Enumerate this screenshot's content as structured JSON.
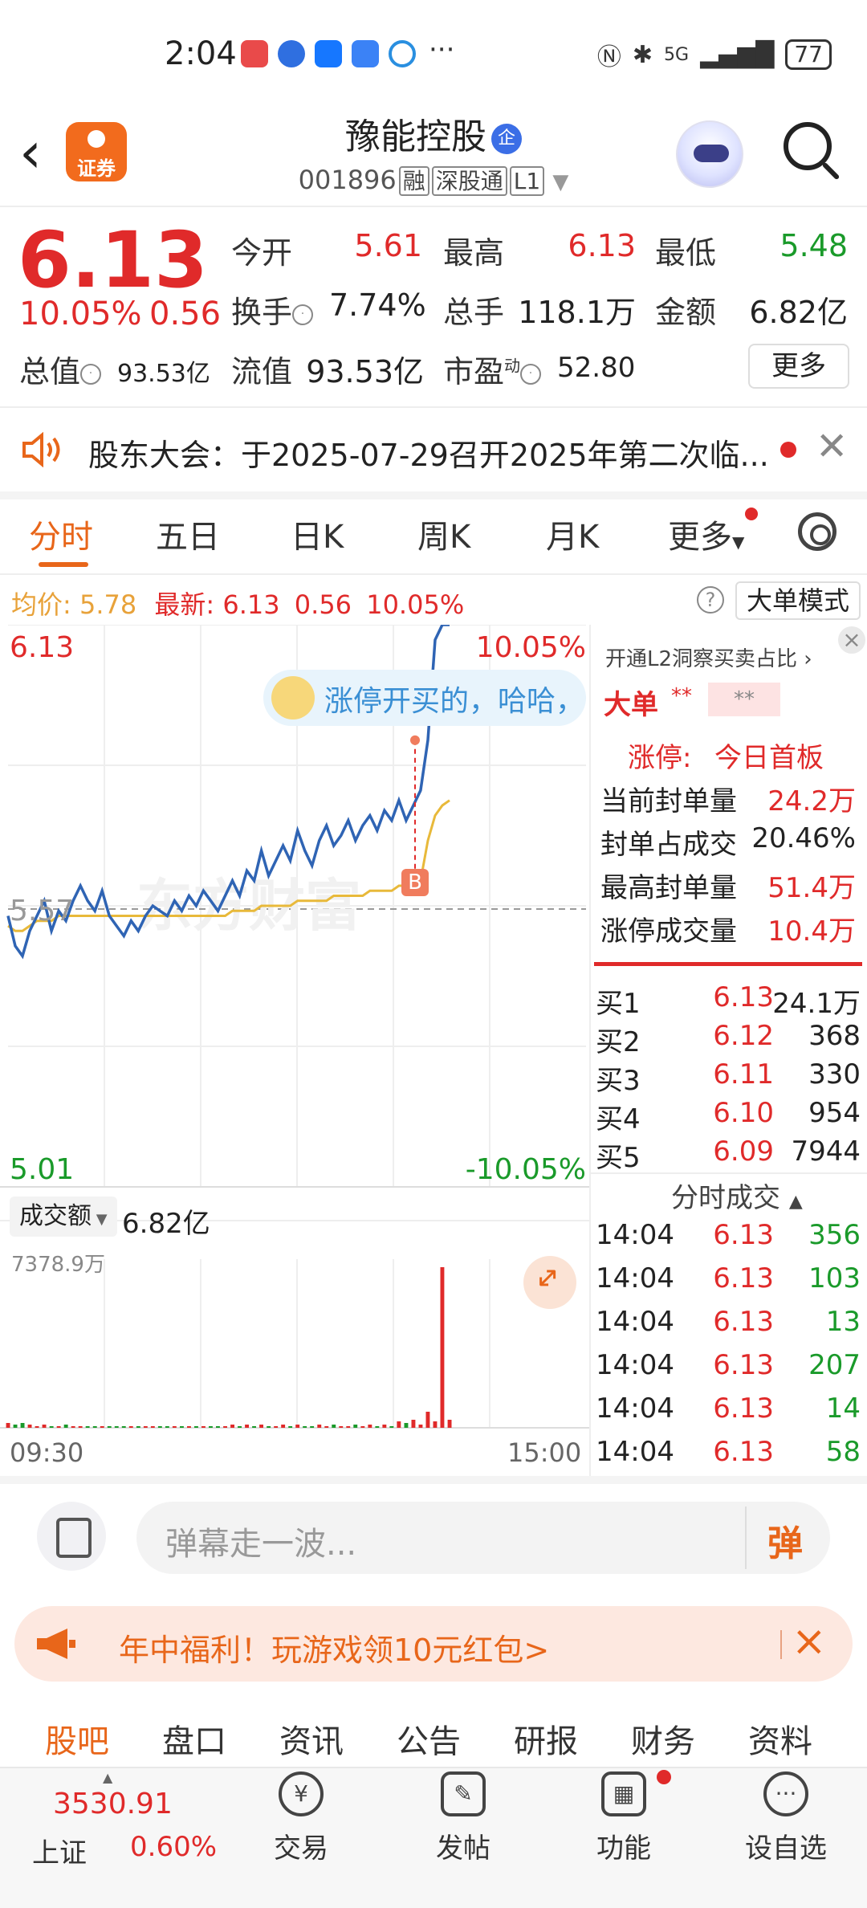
{
  "status_bar": {
    "time": "2:04",
    "dots": "···",
    "network": "5G",
    "battery": "77"
  },
  "header": {
    "logo_text": "证券",
    "stock_name": "豫能控股",
    "company_badge": "企",
    "stock_code": "001896",
    "tags": [
      "融",
      "深股通",
      "L1"
    ]
  },
  "quote": {
    "price": "6.13",
    "change_pct": "10.05%",
    "change": "0.56",
    "open_label": "今开",
    "open": "5.61",
    "high_label": "最高",
    "high": "6.13",
    "low_label": "最低",
    "low": "5.48",
    "turnover_label": "换手",
    "turnover": "7.74%",
    "volume_label": "总手",
    "volume": "118.1万",
    "amount_label": "金额",
    "amount": "6.82亿",
    "mktcap_label": "总值",
    "mktcap": "93.53亿",
    "float_label": "流值",
    "float_cap": "93.53亿",
    "pe_label": "市盈",
    "pe_sup": "动",
    "pe": "52.80",
    "more_label": "更多"
  },
  "notice": {
    "text": "股东大会：于2025-07-29召开2025年第二次临..."
  },
  "tabs": {
    "items": [
      "分时",
      "五日",
      "日K",
      "周K",
      "月K",
      "更多"
    ],
    "active": "分时"
  },
  "avg_bar": {
    "avg_label": "均价:",
    "avg": "5.78",
    "latest_label": "最新:",
    "latest": "6.13",
    "change": "0.56",
    "change_pct": "10.05%",
    "big_order_mode": "大单模式"
  },
  "chart": {
    "price_high": "6.13",
    "price_high_pct": "10.05%",
    "price_mid": "5.57",
    "price_low": "5.01",
    "price_low_pct": "-10.05%",
    "danmu_text": "涨停开买的，哈哈，",
    "b_marker": "B",
    "vol_selector": "成交额",
    "vol_total": "6.82亿",
    "vol_max": "7378.9万",
    "time_start": "09:30",
    "time_end": "15:00",
    "watermark": "东方财富"
  },
  "chart_data": {
    "type": "line",
    "title": "",
    "xlabel": "",
    "ylabel": "",
    "ylim": [
      5.01,
      6.13
    ],
    "series": [
      {
        "name": "",
        "values": [
          5.55,
          5.49,
          5.47,
          5.52,
          5.55,
          5.58,
          5.52,
          5.56,
          5.54,
          5.58,
          5.61,
          5.58,
          5.56,
          5.6,
          5.55,
          5.53,
          5.51,
          5.54,
          5.52,
          5.55,
          5.57,
          5.56,
          5.55,
          5.58,
          5.56,
          5.59,
          5.57,
          5.6,
          5.58,
          5.56,
          5.59,
          5.62,
          5.59,
          5.64,
          5.62,
          5.68,
          5.63,
          5.66,
          5.69,
          5.66,
          5.72,
          5.68,
          5.65,
          5.7,
          5.73,
          5.69,
          5.71,
          5.74,
          5.7,
          5.73,
          5.75,
          5.72,
          5.76,
          5.74,
          5.78,
          5.74,
          5.77,
          5.8,
          5.9,
          6.1,
          6.13,
          6.13
        ]
      },
      {
        "name": "",
        "values": [
          5.53,
          5.52,
          5.52,
          5.53,
          5.54,
          5.54,
          5.54,
          5.55,
          5.55,
          5.55,
          5.55,
          5.55,
          5.55,
          5.55,
          5.55,
          5.55,
          5.55,
          5.55,
          5.55,
          5.55,
          5.55,
          5.55,
          5.55,
          5.55,
          5.55,
          5.55,
          5.55,
          5.55,
          5.55,
          5.55,
          5.55,
          5.56,
          5.56,
          5.56,
          5.56,
          5.57,
          5.57,
          5.57,
          5.57,
          5.57,
          5.58,
          5.58,
          5.58,
          5.58,
          5.58,
          5.59,
          5.59,
          5.59,
          5.59,
          5.59,
          5.6,
          5.6,
          5.6,
          5.6,
          5.61,
          5.61,
          5.61,
          5.62,
          5.7,
          5.75,
          5.77,
          5.78
        ]
      }
    ],
    "volume": [
      3,
      2,
      3,
      2,
      1,
      2,
      1,
      1,
      2,
      1,
      1,
      1,
      1,
      1,
      1,
      1,
      1,
      1,
      1,
      1,
      1,
      1,
      1,
      1,
      1,
      1,
      1,
      1,
      1,
      1,
      1,
      2,
      1,
      2,
      1,
      2,
      1,
      1,
      2,
      1,
      2,
      1,
      1,
      2,
      1,
      2,
      1,
      1,
      2,
      1,
      2,
      1,
      2,
      1,
      4,
      3,
      5,
      2,
      10,
      4,
      100,
      5
    ],
    "colors": {
      "price": "#2f64b4",
      "avg": "#e8b93a",
      "up": "#e02a2a",
      "down": "#1a9a2a"
    }
  },
  "right_panel": {
    "title": "开通L2洞察买卖占比",
    "big_order_label": "大单",
    "masked": "**",
    "limit_up_label": "涨停:",
    "limit_up_value": "今日首板",
    "stats": [
      {
        "label": "当前封单量",
        "value": "24.2万"
      },
      {
        "label": "封单占成交",
        "value": "20.46%"
      },
      {
        "label": "最高封单量",
        "value": "51.4万"
      },
      {
        "label": "涨停成交量",
        "value": "10.4万"
      }
    ],
    "order_book": [
      {
        "label": "买1",
        "price": "6.13",
        "vol": "24.1万"
      },
      {
        "label": "买2",
        "price": "6.12",
        "vol": "368"
      },
      {
        "label": "买3",
        "price": "6.11",
        "vol": "330"
      },
      {
        "label": "买4",
        "price": "6.10",
        "vol": "954"
      },
      {
        "label": "买5",
        "price": "6.09",
        "vol": "7944"
      }
    ],
    "ticks_title": "分时成交",
    "ticks": [
      {
        "time": "14:04",
        "price": "6.13",
        "vol": "356"
      },
      {
        "time": "14:04",
        "price": "6.13",
        "vol": "103"
      },
      {
        "time": "14:04",
        "price": "6.13",
        "vol": "13"
      },
      {
        "time": "14:04",
        "price": "6.13",
        "vol": "207"
      },
      {
        "time": "14:04",
        "price": "6.13",
        "vol": "14"
      },
      {
        "time": "14:04",
        "price": "6.13",
        "vol": "58"
      }
    ]
  },
  "comment_bar": {
    "placeholder": "弹幕走一波...",
    "danmu_button": "弹"
  },
  "promo": {
    "text": "年中福利！玩游戏领10元红包>"
  },
  "bottom_tabs": {
    "items": [
      "股吧",
      "盘口",
      "资讯",
      "公告",
      "研报",
      "财务",
      "资料"
    ],
    "active": "股吧"
  },
  "footer": {
    "index_value": "3530.91",
    "index_name": "上证",
    "index_pct": "0.60%",
    "buttons": [
      {
        "label": "交易",
        "icon": "yen-icon"
      },
      {
        "label": "发帖",
        "icon": "edit-icon"
      },
      {
        "label": "功能",
        "icon": "grid-icon"
      },
      {
        "label": "设自选",
        "icon": "more-icon"
      }
    ]
  }
}
